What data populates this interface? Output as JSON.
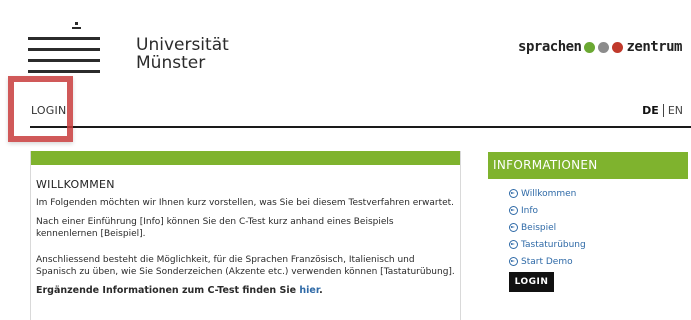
{
  "header": {
    "university_line1": "Universität",
    "university_line2": "Münster",
    "spz_text_left": "sprachen",
    "spz_text_right": "zentrum",
    "spz_dot_colors": [
      "#6aa832",
      "#8c8c8c",
      "#c0392b"
    ]
  },
  "nav": {
    "login_label": "LOGIN",
    "lang_de": "DE",
    "lang_en": "EN"
  },
  "main": {
    "title": "WILLKOMMEN",
    "p1": "Im Folgenden möchten wir Ihnen kurz vorstellen, was Sie bei diesem Testverfahren erwartet.",
    "p2": "Nach einer Einführung [Info] können Sie den C-Test kurz anhand eines Beispiels kennenlernen [Beispiel].",
    "p3": "Anschliessend besteht die Möglichkeit, für die Sprachen Französisch, Italienisch und Spanisch zu üben, wie Sie Sonderzeichen (Akzente etc.) verwenden können [Tastaturübung].",
    "p4_prefix": "Ergänzende Informationen zum C-Test finden Sie",
    "p4_link": "hier",
    "p4_suffix": "."
  },
  "sidebar": {
    "title": "INFORMATIONEN",
    "items": [
      {
        "label": "Willkommen"
      },
      {
        "label": "Info"
      },
      {
        "label": "Beispiel"
      },
      {
        "label": "Tastaturübung"
      },
      {
        "label": "Start Demo"
      }
    ],
    "login_button": "LOGIN"
  },
  "colors": {
    "accent_green": "#7fb32e",
    "link_blue": "#2f6aa7",
    "highlight_red": "#c83c3c"
  }
}
